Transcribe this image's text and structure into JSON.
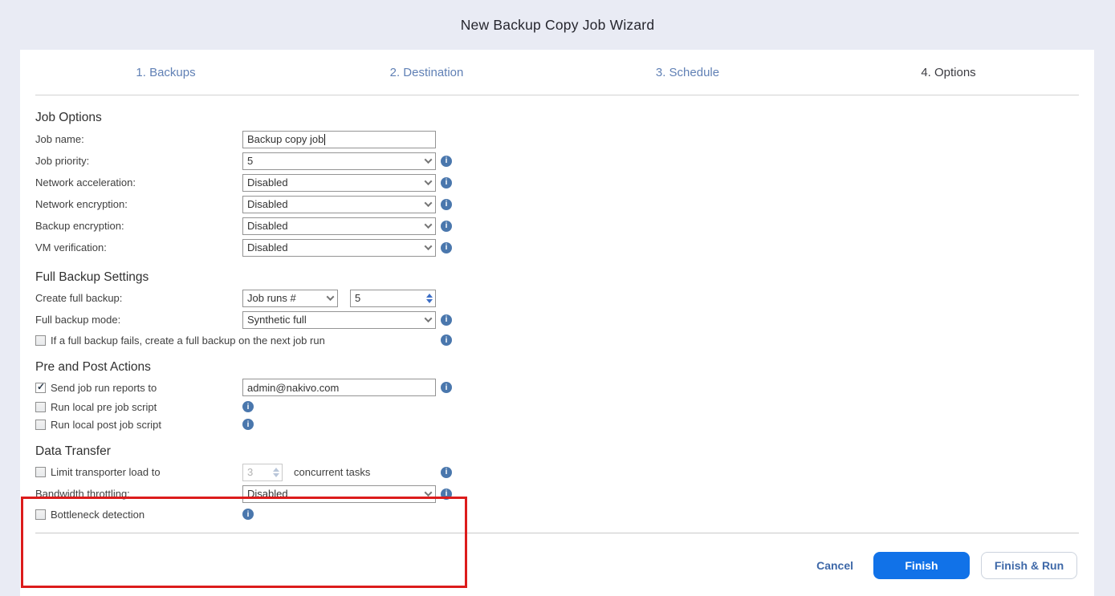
{
  "title": "New Backup Copy Job Wizard",
  "tabs": [
    {
      "label": "1. Backups",
      "active": false
    },
    {
      "label": "2. Destination",
      "active": false
    },
    {
      "label": "3. Schedule",
      "active": false
    },
    {
      "label": "4. Options",
      "active": true
    }
  ],
  "job_options": {
    "heading": "Job Options",
    "job_name": {
      "label": "Job name:",
      "value": "Backup copy job"
    },
    "job_priority": {
      "label": "Job priority:",
      "value": "5"
    },
    "network_acceleration": {
      "label": "Network acceleration:",
      "value": "Disabled"
    },
    "network_encryption": {
      "label": "Network encryption:",
      "value": "Disabled"
    },
    "backup_encryption": {
      "label": "Backup encryption:",
      "value": "Disabled"
    },
    "vm_verification": {
      "label": "VM verification:",
      "value": "Disabled"
    }
  },
  "full_backup": {
    "heading": "Full Backup Settings",
    "create_full_backup": {
      "label": "Create full backup:",
      "mode": "Job runs #",
      "count": "5"
    },
    "full_backup_mode": {
      "label": "Full backup mode:",
      "value": "Synthetic full"
    },
    "fail_checkbox": {
      "label": "If a full backup fails, create a full backup on the next job run",
      "checked": false
    }
  },
  "pre_post": {
    "heading": "Pre and Post Actions",
    "send_reports": {
      "label": "Send job run reports to",
      "checked": true,
      "value": "admin@nakivo.com"
    },
    "pre_script": {
      "label": "Run local pre job script",
      "checked": false
    },
    "post_script": {
      "label": "Run local post job script",
      "checked": false
    }
  },
  "data_transfer": {
    "heading": "Data Transfer",
    "limit_transporter": {
      "label": "Limit transporter load to",
      "checked": false,
      "value": "3",
      "suffix": "concurrent tasks"
    },
    "bandwidth_throttling": {
      "label": "Bandwidth throttling:",
      "value": "Disabled"
    },
    "bottleneck_detection": {
      "label": "Bottleneck detection",
      "checked": false
    }
  },
  "footer": {
    "cancel": "Cancel",
    "finish": "Finish",
    "finish_run": "Finish & Run"
  },
  "colors": {
    "page_background": "#e9ebf4",
    "accent_blue": "#1172e8",
    "tab_blue": "#6080b5",
    "info_icon_blue": "#4a77ad",
    "highlight_red": "#dc1c1c"
  }
}
